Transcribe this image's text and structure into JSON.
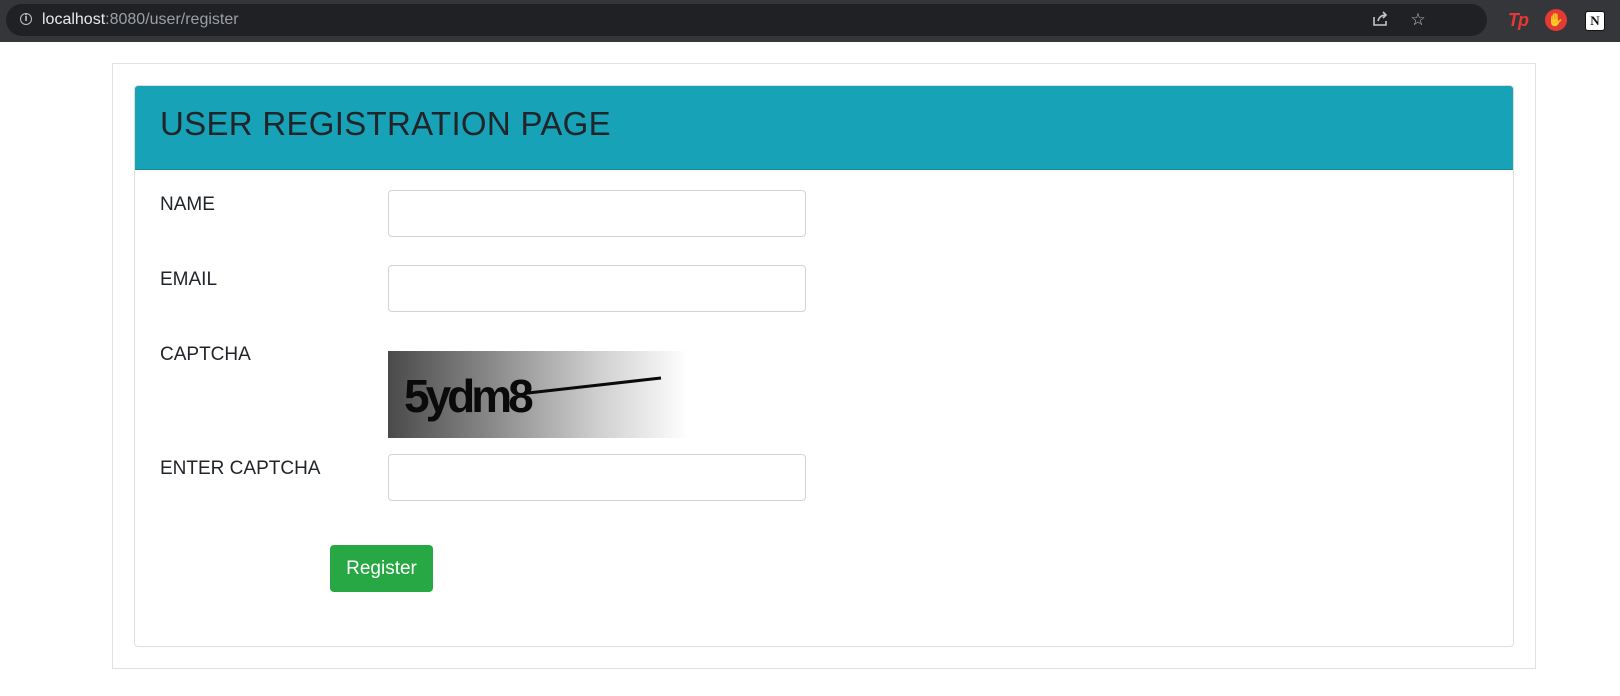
{
  "browser": {
    "url_host": "localhost",
    "url_rest": ":8080/user/register",
    "icons": [
      "info-icon",
      "share-icon",
      "bookmark-star-icon",
      "toggl-track-extension-icon",
      "stop-hand-extension-icon",
      "notion-extension-icon"
    ],
    "extension_labels": {
      "tp": "Tp",
      "stop": "✋",
      "notion": "N"
    }
  },
  "card": {
    "title": "USER REGISTRATION PAGE",
    "header_color": "#17a2b8"
  },
  "form": {
    "name_label": "NAME",
    "name_value": "",
    "email_label": "EMAIL",
    "email_value": "",
    "captcha_label": "CAPTCHA",
    "captcha_text": "5ydm8",
    "enter_captcha_label": "ENTER CAPTCHA",
    "enter_captcha_value": "",
    "register_label": "Register",
    "register_color": "#28a745"
  }
}
